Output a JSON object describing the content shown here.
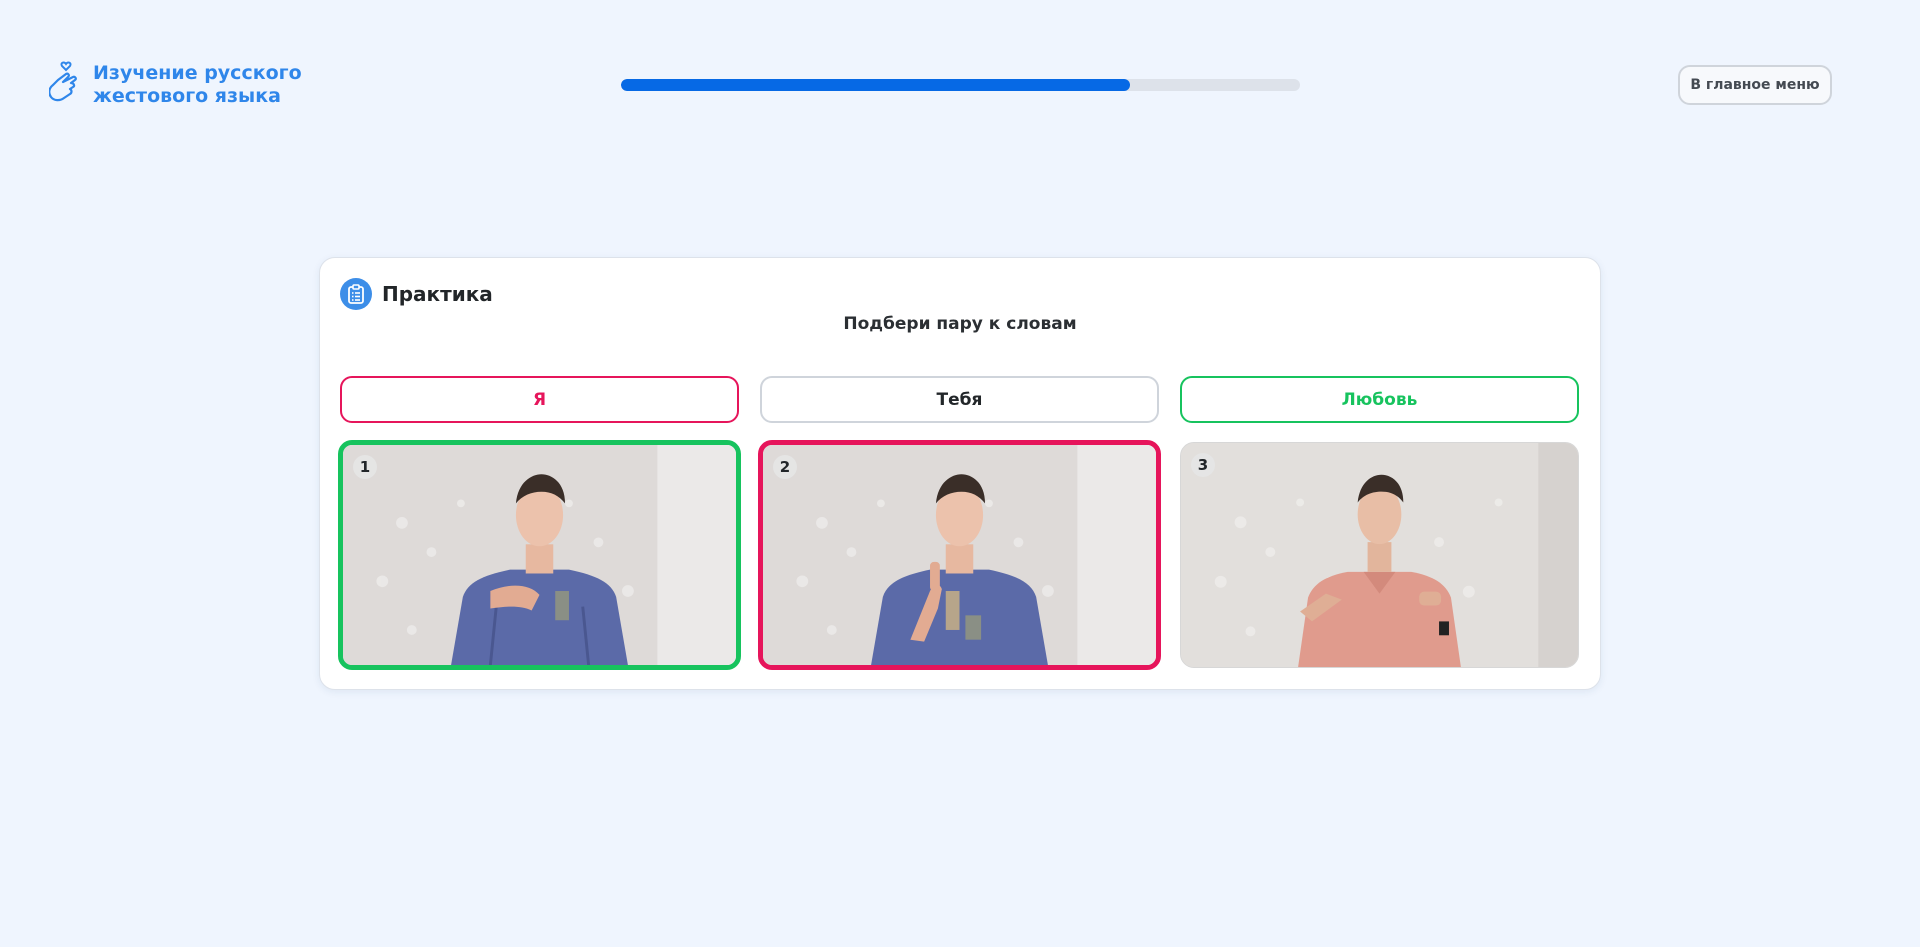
{
  "header": {
    "logo_line1": "Изучение русского",
    "logo_line2": "жестового языка",
    "menu_button": "В главное меню"
  },
  "progress": {
    "value": 0.75
  },
  "card": {
    "title": "Практика",
    "subtitle": "Подбери пару к словам",
    "words": [
      {
        "label": "Я",
        "state": "incorrect"
      },
      {
        "label": "Тебя",
        "state": "neutral"
      },
      {
        "label": "Любовь",
        "state": "correct"
      }
    ],
    "videos": [
      {
        "number": "1",
        "state": "correct",
        "shirt": "blue"
      },
      {
        "number": "2",
        "state": "incorrect",
        "shirt": "blue"
      },
      {
        "number": "3",
        "state": "neutral",
        "shirt": "pink"
      }
    ]
  },
  "colors": {
    "accent": "#0669e5",
    "brand": "#2f86ea",
    "correct": "#17c35e",
    "incorrect": "#e6155b"
  }
}
